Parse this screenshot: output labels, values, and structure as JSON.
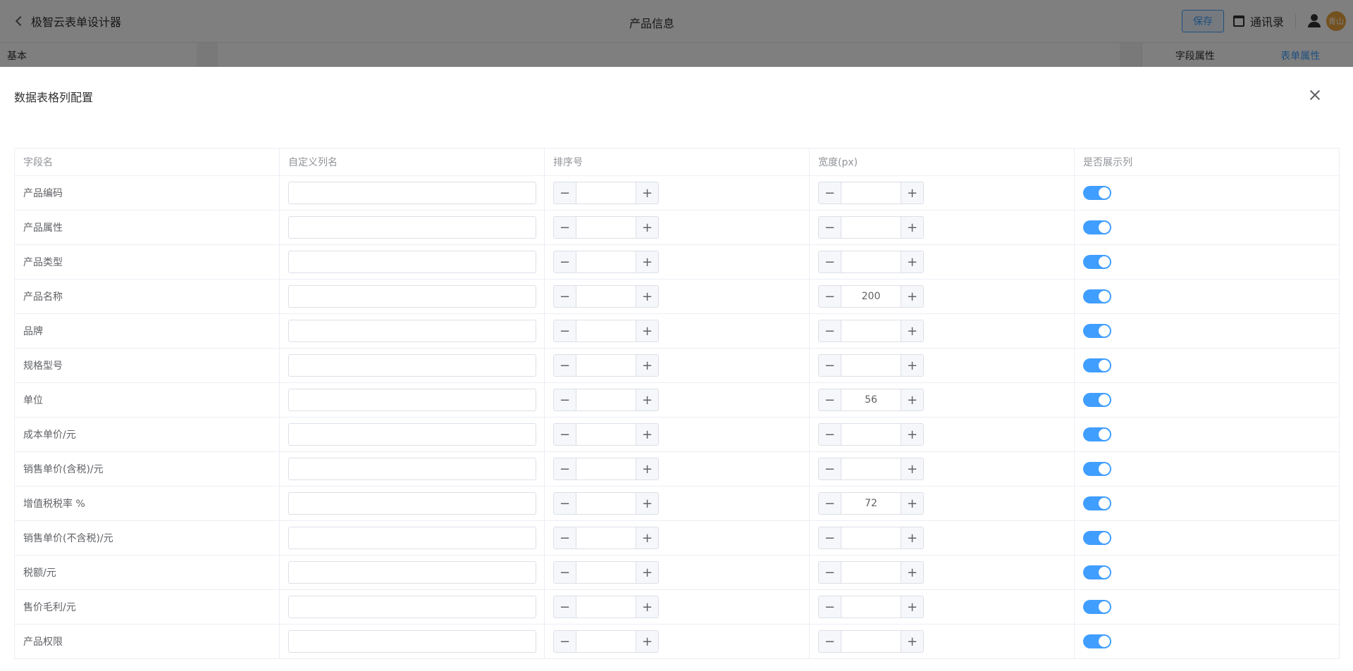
{
  "topbar": {
    "back_label": "极智云表单设计器",
    "page_title": "产品信息",
    "save_label": "保存",
    "contacts_label": "通讯录",
    "avatar_text": "青山"
  },
  "leftpanel": {
    "header": "基本"
  },
  "rightpanel": {
    "tab_field": "字段属性",
    "tab_form": "表单属性"
  },
  "drawer": {
    "title": "数据表格列配置",
    "columns": [
      "字段名",
      "自定义列名",
      "排序号",
      "宽度(px)",
      "是否展示列"
    ],
    "rows": [
      {
        "field": "产品编码",
        "custom_name": "",
        "order": "",
        "width": "",
        "show": true
      },
      {
        "field": "产品属性",
        "custom_name": "",
        "order": "",
        "width": "",
        "show": true
      },
      {
        "field": "产品类型",
        "custom_name": "",
        "order": "",
        "width": "",
        "show": true
      },
      {
        "field": "产品名称",
        "custom_name": "",
        "order": "",
        "width": "200",
        "show": true
      },
      {
        "field": "品牌",
        "custom_name": "",
        "order": "",
        "width": "",
        "show": true
      },
      {
        "field": "规格型号",
        "custom_name": "",
        "order": "",
        "width": "",
        "show": true
      },
      {
        "field": "单位",
        "custom_name": "",
        "order": "",
        "width": "56",
        "show": true
      },
      {
        "field": "成本单价/元",
        "custom_name": "",
        "order": "",
        "width": "",
        "show": true
      },
      {
        "field": "销售单价(含税)/元",
        "custom_name": "",
        "order": "",
        "width": "",
        "show": true
      },
      {
        "field": "增值税税率 %",
        "custom_name": "",
        "order": "",
        "width": "72",
        "show": true
      },
      {
        "field": "销售单价(不含税)/元",
        "custom_name": "",
        "order": "",
        "width": "",
        "show": true
      },
      {
        "field": "税额/元",
        "custom_name": "",
        "order": "",
        "width": "",
        "show": true
      },
      {
        "field": "售价毛利/元",
        "custom_name": "",
        "order": "",
        "width": "",
        "show": true
      },
      {
        "field": "产品权限",
        "custom_name": "",
        "order": "",
        "width": "",
        "show": true
      }
    ]
  },
  "colors": {
    "accent": "#409eff",
    "avatar_bg": "#e6a23c"
  }
}
